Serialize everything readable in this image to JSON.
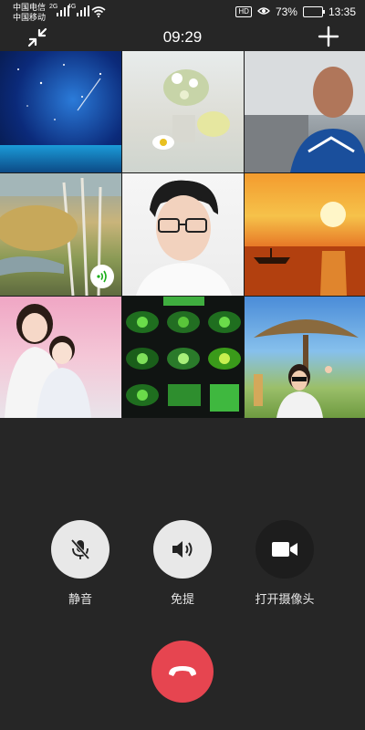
{
  "status_bar": {
    "carrier_1": "中国电信",
    "carrier_1_net": "2G",
    "carrier_2": "中国移动",
    "carrier_2_net": "4G",
    "hd": "HD",
    "battery": "73%",
    "time": "13:35"
  },
  "call": {
    "duration": "09:29"
  },
  "participants": [
    {
      "label": "starry-night"
    },
    {
      "label": "flowers"
    },
    {
      "label": "man-video"
    },
    {
      "label": "forest",
      "speaking": true
    },
    {
      "label": "young-man"
    },
    {
      "label": "sunset-sea"
    },
    {
      "label": "two-girls"
    },
    {
      "label": "green-eyes"
    },
    {
      "label": "woman-park"
    }
  ],
  "controls": {
    "mute_label": "静音",
    "speaker_label": "免提",
    "camera_label": "打开摄像头"
  },
  "colors": {
    "background": "#262626",
    "hangup": "#e64550",
    "button_light": "#e8e8e8",
    "button_dark": "#1d1d1d",
    "speaking": "#1aad19"
  }
}
